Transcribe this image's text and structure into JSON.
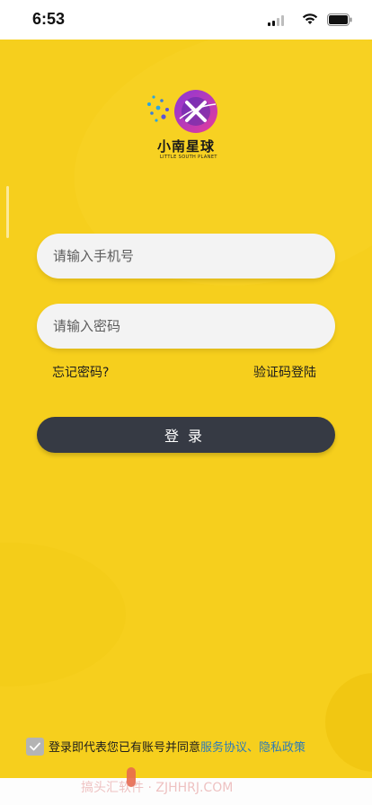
{
  "status_bar": {
    "time": "6:53"
  },
  "logo": {
    "name": "小南星球",
    "subtitle": "LITTLE SOUTH PLANET",
    "accent_colors": [
      "#8a38d6",
      "#e63c9b",
      "#2aa6e0"
    ]
  },
  "login_form": {
    "phone_placeholder": "请输入手机号",
    "password_placeholder": "请输入密码",
    "forgot_password_label": "忘记密码?",
    "sms_login_label": "验证码登陆",
    "login_button_label": "登录"
  },
  "agreement": {
    "checked": true,
    "prefix_text": "登录即代表您已有账号并同意",
    "terms_link": "服务协议",
    "separator": "、",
    "privacy_link": "隐私政策"
  },
  "watermark": {
    "text": "搞头汇软件 · ZJHHRJ.COM"
  },
  "colors": {
    "background": "#f6cf1d",
    "field": "#f3f3f3",
    "button": "#363a44",
    "link": "#2e7bb8"
  }
}
